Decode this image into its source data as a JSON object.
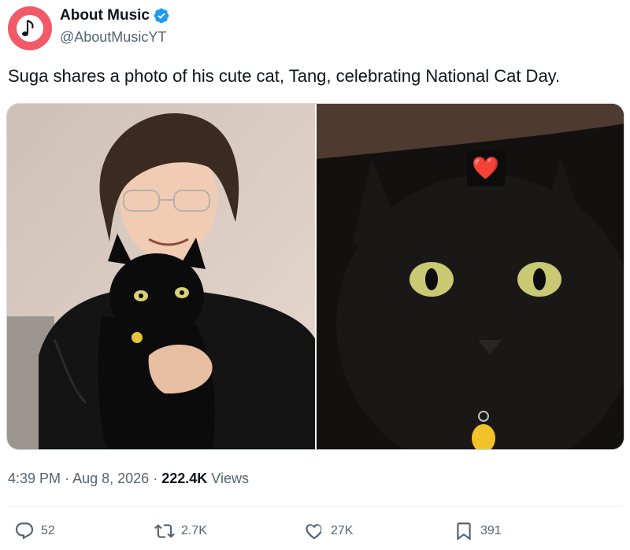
{
  "author": {
    "name": "About Music",
    "handle": "@AboutMusicYT",
    "verified": true,
    "avatar_icon": "music-note-icon",
    "avatar_color": "#f15a66"
  },
  "tweet": {
    "text": "Suga shares a photo of his cute cat, Tang, celebrating National Cat Day.",
    "time": "4:39 PM",
    "separator1": "·",
    "date": "Aug 8, 2026",
    "separator2": "·",
    "views_count": "222.4K",
    "views_label": "Views"
  },
  "media": [
    {
      "icon": "photo-man-with-black-cat"
    },
    {
      "icon": "photo-black-cat-closeup",
      "overlay_emoji": "❤️"
    }
  ],
  "actions": {
    "reply": {
      "icon": "reply-icon",
      "count": "52"
    },
    "retweet": {
      "icon": "retweet-icon",
      "count": "2.7K"
    },
    "like": {
      "icon": "heart-icon",
      "count": "27K"
    },
    "bookmark": {
      "icon": "bookmark-icon",
      "count": "391"
    }
  },
  "colors": {
    "verified_badge": "#1d9bf0",
    "secondary_text": "#536471",
    "primary_text": "#0f1419"
  }
}
